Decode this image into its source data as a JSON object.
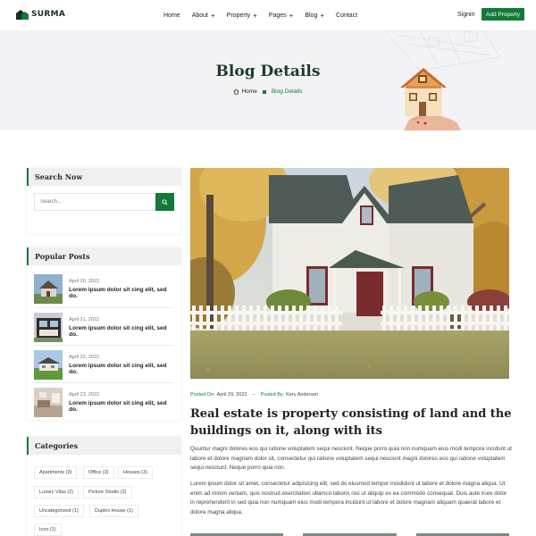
{
  "header": {
    "logo_text": "SURMA",
    "nav": [
      {
        "label": "Home",
        "has_plus": false
      },
      {
        "label": "About",
        "has_plus": true
      },
      {
        "label": "Property",
        "has_plus": true
      },
      {
        "label": "Pages",
        "has_plus": true
      },
      {
        "label": "Blog",
        "has_plus": true
      },
      {
        "label": "Contact",
        "has_plus": false
      }
    ],
    "signin": "Signin",
    "add_property": "Add Property"
  },
  "hero": {
    "title": "Blog Details",
    "breadcrumb_home": "Home",
    "breadcrumb_current": "Blog Details"
  },
  "sidebar": {
    "search": {
      "title": "Search Now",
      "placeholder": "Search..."
    },
    "popular": {
      "title": "Popular Posts",
      "posts": [
        {
          "date": "April 20, 2022",
          "title": "Lorem ipsum dolor sit cing elit, sed do."
        },
        {
          "date": "April 21, 2022",
          "title": "Lorem ipsum dolor sit cing elit, sed do."
        },
        {
          "date": "April 22, 2022",
          "title": "Lorem ipsum dolor sit cing elit, sed do."
        },
        {
          "date": "April 23, 2022",
          "title": "Lorem ipsum dolor sit cing elit, sed do."
        }
      ]
    },
    "categories": {
      "title": "Categories",
      "items": [
        "Apartments (3)",
        "Office (3)",
        "Houses (3)",
        "Luxary Vilas (2)",
        "Picture Stodio (2)",
        "Uncategorized (1)",
        "Duplex House (1)",
        "Icon (1)"
      ]
    }
  },
  "article": {
    "posted_on_label": "Posted On:",
    "posted_on_value": "April 29, 2022",
    "posted_by_label": "Posted By:",
    "posted_by_value": "Kery Anderson",
    "title": "Real estate is property consisting of land and the buildings on it, along with its",
    "paragraph1": "Quuntur magni dolores eos qui ratione voluptatem sequi nesciunt. Neque porro quia non numquam eius modi tempora incidunt ut labore et dolore magnam dolor sit, consectetur qui ratione voluptatem sequi nesciunt magni dolores eos qui ratione voluptatem sequi nesciunt. Neque porro quia non.",
    "paragraph2": "Lorem ipsum dolor sit amet, consectetur adipisicing elit, sed do eiusmod tempor incididunt ut labore et dolore magna aliqua. Ut enim ad minim veniam, quis nostrud exercitation ullamco laboris nisi ut aliquip ex ea commodo consequat. Duis aute irure dolor in reprehenderit in sed quia non numquam eius modi tempora incidunt ut labore et dolore magnam aliquam quaerat labore et dolore magna aliqua."
  },
  "colors": {
    "accent": "#117a38",
    "hero_bg": "#f3f3f5",
    "heading": "#1f3a2a"
  }
}
